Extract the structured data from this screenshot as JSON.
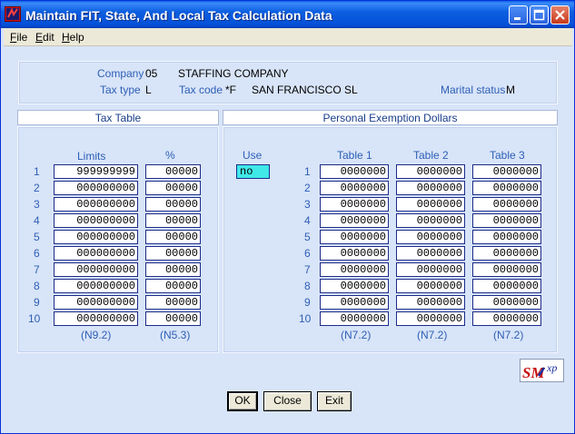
{
  "window": {
    "title": "Maintain FIT, State, And Local Tax Calculation Data"
  },
  "menu": {
    "file": {
      "ul": "F",
      "rest": "ile"
    },
    "edit": {
      "ul": "E",
      "rest": "dit"
    },
    "help": {
      "ul": "H",
      "rest": "elp"
    }
  },
  "info": {
    "company_label": "Company",
    "company_code": "05",
    "company_name": "STAFFING COMPANY",
    "tax_type_label": "Tax type",
    "tax_type": "L",
    "tax_code_label": "Tax code",
    "tax_code": "*F",
    "tax_code_name": "SAN FRANCISCO SL",
    "marital_label": "Marital status",
    "marital_status": "M"
  },
  "tax_table": {
    "header": "Tax Table",
    "col_limits": "Limits",
    "col_percent": "%",
    "rows": [
      {
        "n": "1",
        "limit": "999999999",
        "pct": "00000"
      },
      {
        "n": "2",
        "limit": "000000000",
        "pct": "00000"
      },
      {
        "n": "3",
        "limit": "000000000",
        "pct": "00000"
      },
      {
        "n": "4",
        "limit": "000000000",
        "pct": "00000"
      },
      {
        "n": "5",
        "limit": "000000000",
        "pct": "00000"
      },
      {
        "n": "6",
        "limit": "000000000",
        "pct": "00000"
      },
      {
        "n": "7",
        "limit": "000000000",
        "pct": "00000"
      },
      {
        "n": "8",
        "limit": "000000000",
        "pct": "00000"
      },
      {
        "n": "9",
        "limit": "000000000",
        "pct": "00000"
      },
      {
        "n": "10",
        "limit": "000000000",
        "pct": "00000"
      }
    ],
    "fmt_limits": "(N9.2)",
    "fmt_percent": "(N5.3)"
  },
  "exemption": {
    "header": "Personal Exemption Dollars",
    "use_label": "Use",
    "use_value": "no",
    "col_t1": "Table 1",
    "col_t2": "Table 2",
    "col_t3": "Table 3",
    "rows": [
      {
        "n": "1",
        "t1": "0000000",
        "t2": "0000000",
        "t3": "0000000"
      },
      {
        "n": "2",
        "t1": "0000000",
        "t2": "0000000",
        "t3": "0000000"
      },
      {
        "n": "3",
        "t1": "0000000",
        "t2": "0000000",
        "t3": "0000000"
      },
      {
        "n": "4",
        "t1": "0000000",
        "t2": "0000000",
        "t3": "0000000"
      },
      {
        "n": "5",
        "t1": "0000000",
        "t2": "0000000",
        "t3": "0000000"
      },
      {
        "n": "6",
        "t1": "0000000",
        "t2": "0000000",
        "t3": "0000000"
      },
      {
        "n": "7",
        "t1": "0000000",
        "t2": "0000000",
        "t3": "0000000"
      },
      {
        "n": "8",
        "t1": "0000000",
        "t2": "0000000",
        "t3": "0000000"
      },
      {
        "n": "9",
        "t1": "0000000",
        "t2": "0000000",
        "t3": "0000000"
      },
      {
        "n": "10",
        "t1": "0000000",
        "t2": "0000000",
        "t3": "0000000"
      }
    ],
    "fmt_t1": "(N7.2)",
    "fmt_t2": "(N7.2)",
    "fmt_t3": "(N7.2)"
  },
  "buttons": {
    "ok": "OK",
    "close": "Close",
    "exit": "Exit"
  },
  "logo": {
    "text_main": "SM",
    "text_sub": "xp"
  },
  "colors": {
    "titlebar": "#0550d8",
    "client_bg": "#d8e4f8",
    "label": "#2d5fb5",
    "use_field": "#40e8e8"
  }
}
